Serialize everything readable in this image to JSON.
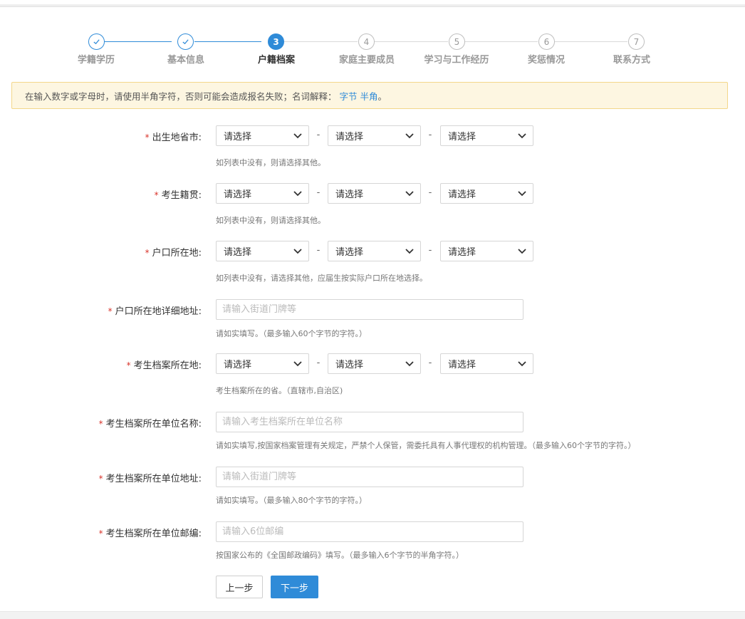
{
  "steps": [
    {
      "number": "1",
      "label": "学籍学历",
      "state": "done"
    },
    {
      "number": "2",
      "label": "基本信息",
      "state": "done"
    },
    {
      "number": "3",
      "label": "户籍档案",
      "state": "active"
    },
    {
      "number": "4",
      "label": "家庭主要成员",
      "state": "todo"
    },
    {
      "number": "5",
      "label": "学习与工作经历",
      "state": "todo"
    },
    {
      "number": "6",
      "label": "奖惩情况",
      "state": "todo"
    },
    {
      "number": "7",
      "label": "联系方式",
      "state": "todo"
    }
  ],
  "notice": {
    "text": "在输入数字或字母时，请使用半角字符，否则可能会造成报名失败；名词解释：",
    "link1": "字节",
    "link2": "半角",
    "tail": "。"
  },
  "form": {
    "required_mark": "*",
    "separator": "-",
    "select_placeholder": "请选择",
    "birthplace": {
      "label": "出生地省市:",
      "hint": "如列表中没有，则请选择其他。"
    },
    "native_place": {
      "label": "考生籍贯:",
      "hint": "如列表中没有，则请选择其他。"
    },
    "hukou": {
      "label": "户口所在地:",
      "hint": "如列表中没有，请选择其他，应届生按实际户口所在地选择。"
    },
    "hukou_address": {
      "label": "户口所在地详细地址:",
      "placeholder": "请输入街道门牌等",
      "hint": "请如实填写。（最多输入60个字节的字符。）"
    },
    "archive_location": {
      "label": "考生档案所在地:",
      "hint": "考生档案所在的省。（直辖市,自治区)"
    },
    "archive_unit_name": {
      "label": "考生档案所在单位名称:",
      "placeholder": "请输入考生档案所在单位名称",
      "hint": "请如实填写,按国家档案管理有关规定，严禁个人保管，需委托具有人事代理权的机构管理。（最多输入60个字节的字符。）"
    },
    "archive_unit_address": {
      "label": "考生档案所在单位地址:",
      "placeholder": "请输入街道门牌等",
      "hint": "请如实填写。（最多输入80个字节的字符。）"
    },
    "archive_unit_postcode": {
      "label": "考生档案所在单位邮编:",
      "placeholder": "请输入6位邮编",
      "hint": "按国家公布的《全国邮政编码》填写。（最多输入6个字节的半角字符。）"
    }
  },
  "buttons": {
    "prev": "上一步",
    "next": "下一步"
  },
  "colors": {
    "accent": "#2f8bd8",
    "required": "#d9342b",
    "notice_bg": "#fdf6e1",
    "notice_border": "#f3d78a"
  }
}
